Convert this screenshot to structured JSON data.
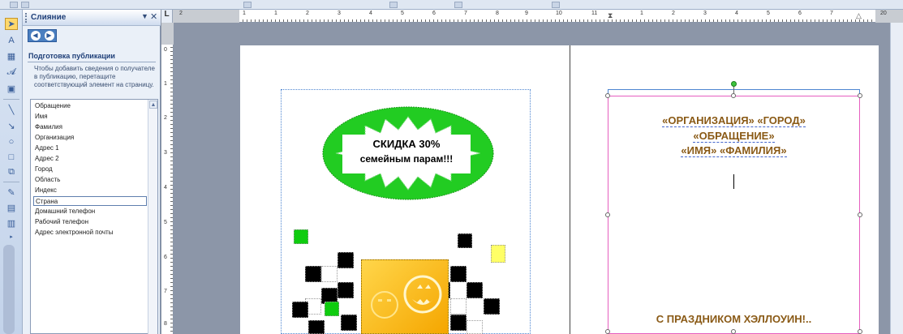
{
  "pane": {
    "title": "Слияние",
    "menu_glyph": "▼",
    "close_glyph": "✕",
    "section_heading": "Подготовка публикации",
    "instructions": "Чтобы добавить сведения о получателе в публикацию, перетащите соответствующий элемент на страницу.",
    "fields": [
      "Обращение",
      "Имя",
      "Фамилия",
      "Организация",
      "Адрес 1",
      "Адрес 2",
      "Город",
      "Область",
      "Индекс",
      "Страна",
      "Домашний телефон",
      "Рабочий телефон",
      "Адрес электронной почты"
    ],
    "selected_field": "Страна"
  },
  "ruler": {
    "corner": "L",
    "h_numbers": [
      "2",
      "1",
      "1",
      "2",
      "3",
      "4",
      "5",
      "6",
      "7",
      "8",
      "9",
      "10",
      "11",
      "1",
      "2",
      "3",
      "4",
      "5",
      "6",
      "7",
      "20"
    ],
    "v_numbers": [
      "0",
      "1",
      "2",
      "3",
      "4",
      "5",
      "6",
      "7",
      "8"
    ]
  },
  "flyer": {
    "badge_title": "СКИДКА 30%",
    "badge_subtitle": "семейным парам!!!"
  },
  "envelope": {
    "line1": "«ОРГАНИЗАЦИЯ»  «ГОРОД»",
    "line2": "«ОБРАЩЕНИЕ»",
    "line3": "«ИМЯ» «ФАМИЛИЯ»",
    "greeting": "С ПРАЗДНИКОМ ХЭЛЛОУИН!.."
  },
  "colors": {
    "accent_green": "#22cc22",
    "merge_field_brown": "#8a5a16",
    "textbox_border_pink": "#e65fbf",
    "pumpkin_yellow": "#ffd64a"
  },
  "icons": {
    "tools": [
      "select-arrow-icon",
      "text-box-icon",
      "table-icon",
      "word-art-icon",
      "picture-icon",
      "line-icon",
      "arrow-line-icon",
      "oval-icon",
      "rectangle-icon",
      "autoshapes-icon",
      "fill-color-icon",
      "line-color-icon",
      "design-gallery-icon",
      "more-tools-icon"
    ]
  }
}
